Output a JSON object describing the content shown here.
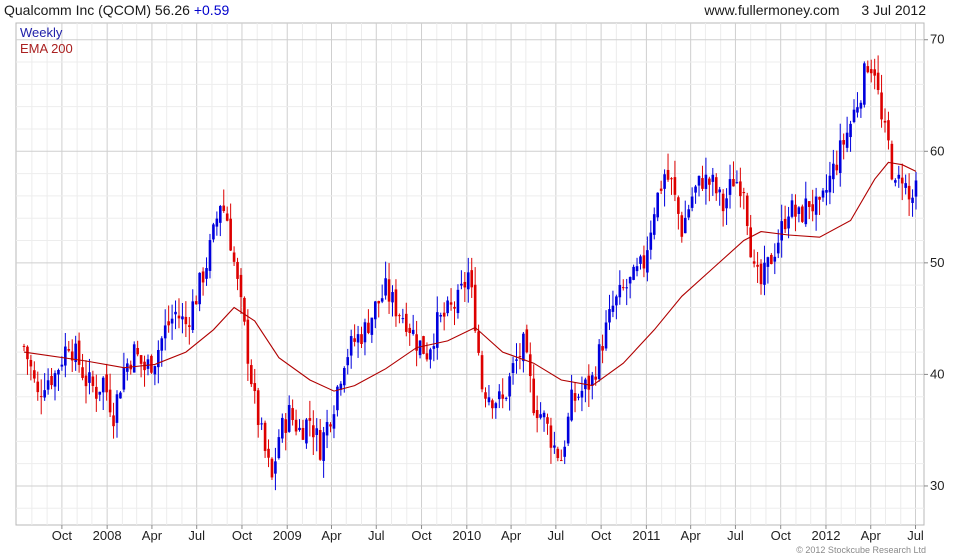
{
  "header": {
    "security": "Qualcomm Inc (QCOM)",
    "last": "56.26",
    "change": "+0.59",
    "site": "www.fullermoney.com",
    "date": "3 Jul 2012"
  },
  "copyright": "© 2012 Stockcube Research Ltd",
  "colors": {
    "up": "#0000dd",
    "down": "#dd0000",
    "ema": "#b00000",
    "grid": "#cfcfcf",
    "legend_weekly": "#2020aa",
    "legend_ema": "#aa2020"
  },
  "chart_data": {
    "type": "candlestick",
    "title": "Qualcomm Inc (QCOM)",
    "frequency": "Weekly",
    "grid": true,
    "legend": {
      "placement": "top-left",
      "entries": [
        "Weekly",
        "EMA 200"
      ]
    },
    "y_axis": {
      "position": "right",
      "ylim": [
        26.5,
        71.5
      ],
      "ticks": [
        30,
        40,
        50,
        60,
        70
      ]
    },
    "x_axis": {
      "range": [
        "2007-07-16",
        "2012-07-02"
      ],
      "tick_labels": [
        {
          "label": "Oct",
          "date": "2007-10-01"
        },
        {
          "label": "2008",
          "date": "2008-01-01"
        },
        {
          "label": "Apr",
          "date": "2008-04-01"
        },
        {
          "label": "Jul",
          "date": "2008-07-01"
        },
        {
          "label": "Oct",
          "date": "2008-10-01"
        },
        {
          "label": "2009",
          "date": "2009-01-01"
        },
        {
          "label": "Apr",
          "date": "2009-04-01"
        },
        {
          "label": "Jul",
          "date": "2009-07-01"
        },
        {
          "label": "Oct",
          "date": "2009-10-01"
        },
        {
          "label": "2010",
          "date": "2010-01-01"
        },
        {
          "label": "Apr",
          "date": "2010-04-01"
        },
        {
          "label": "Jul",
          "date": "2010-07-01"
        },
        {
          "label": "Oct",
          "date": "2010-10-01"
        },
        {
          "label": "2011",
          "date": "2011-01-01"
        },
        {
          "label": "Apr",
          "date": "2011-04-01"
        },
        {
          "label": "Jul",
          "date": "2011-07-01"
        },
        {
          "label": "Oct",
          "date": "2011-10-01"
        },
        {
          "label": "2012",
          "date": "2012-01-01"
        },
        {
          "label": "Apr",
          "date": "2012-04-01"
        },
        {
          "label": "Jul",
          "date": "2012-07-01"
        }
      ]
    },
    "price_close_path": [
      [
        "2007-07-16",
        42.5
      ],
      [
        "2007-07-30",
        40.5
      ],
      [
        "2007-08-13",
        38.0
      ],
      [
        "2007-08-27",
        39.5
      ],
      [
        "2007-09-17",
        40.0
      ],
      [
        "2007-10-01",
        41.5
      ],
      [
        "2007-10-15",
        43.0
      ],
      [
        "2007-11-05",
        41.0
      ],
      [
        "2007-11-19",
        39.5
      ],
      [
        "2007-12-10",
        38.5
      ],
      [
        "2007-12-24",
        39.5
      ],
      [
        "2008-01-14",
        36.5
      ],
      [
        "2008-02-04",
        40.5
      ],
      [
        "2008-02-25",
        42.0
      ],
      [
        "2008-03-17",
        40.5
      ],
      [
        "2008-04-07",
        41.5
      ],
      [
        "2008-04-28",
        44.0
      ],
      [
        "2008-05-19",
        45.5
      ],
      [
        "2008-06-09",
        44.5
      ],
      [
        "2008-06-30",
        47.0
      ],
      [
        "2008-07-21",
        50.0
      ],
      [
        "2008-08-04",
        52.5
      ],
      [
        "2008-08-18",
        55.5
      ],
      [
        "2008-09-01",
        54.0
      ],
      [
        "2008-09-15",
        50.0
      ],
      [
        "2008-10-06",
        44.0
      ],
      [
        "2008-10-27",
        37.5
      ],
      [
        "2008-11-17",
        33.0
      ],
      [
        "2008-12-01",
        30.5
      ],
      [
        "2008-12-15",
        34.5
      ],
      [
        "2009-01-05",
        36.5
      ],
      [
        "2009-01-26",
        35.0
      ],
      [
        "2009-02-16",
        36.0
      ],
      [
        "2009-03-09",
        33.5
      ],
      [
        "2009-04-06",
        37.5
      ],
      [
        "2009-04-27",
        41.5
      ],
      [
        "2009-05-18",
        43.0
      ],
      [
        "2009-06-08",
        44.0
      ],
      [
        "2009-06-29",
        46.0
      ],
      [
        "2009-07-20",
        47.5
      ],
      [
        "2009-08-10",
        46.0
      ],
      [
        "2009-08-31",
        45.0
      ],
      [
        "2009-09-21",
        43.0
      ],
      [
        "2009-10-12",
        42.0
      ],
      [
        "2009-11-02",
        44.5
      ],
      [
        "2009-11-23",
        45.5
      ],
      [
        "2009-12-14",
        46.5
      ],
      [
        "2010-01-04",
        49.0
      ],
      [
        "2010-01-18",
        45.0
      ],
      [
        "2010-02-01",
        39.0
      ],
      [
        "2010-02-22",
        38.0
      ],
      [
        "2010-03-15",
        37.5
      ],
      [
        "2010-04-05",
        40.5
      ],
      [
        "2010-04-26",
        42.5
      ],
      [
        "2010-05-17",
        37.5
      ],
      [
        "2010-06-07",
        36.0
      ],
      [
        "2010-06-28",
        33.5
      ],
      [
        "2010-07-12",
        32.5
      ],
      [
        "2010-08-02",
        37.5
      ],
      [
        "2010-08-23",
        38.5
      ],
      [
        "2010-09-13",
        39.5
      ],
      [
        "2010-10-04",
        43.0
      ],
      [
        "2010-10-25",
        46.0
      ],
      [
        "2010-11-15",
        47.5
      ],
      [
        "2010-12-06",
        48.5
      ],
      [
        "2010-12-27",
        50.0
      ],
      [
        "2011-01-17",
        55.0
      ],
      [
        "2011-02-07",
        58.0
      ],
      [
        "2011-02-21",
        57.0
      ],
      [
        "2011-03-14",
        53.0
      ],
      [
        "2011-04-04",
        56.0
      ],
      [
        "2011-04-25",
        57.5
      ],
      [
        "2011-05-16",
        57.0
      ],
      [
        "2011-06-06",
        55.0
      ],
      [
        "2011-06-27",
        57.5
      ],
      [
        "2011-07-18",
        57.0
      ],
      [
        "2011-08-08",
        49.0
      ],
      [
        "2011-08-22",
        48.0
      ],
      [
        "2011-09-12",
        50.5
      ],
      [
        "2011-10-03",
        53.0
      ],
      [
        "2011-10-17",
        55.0
      ],
      [
        "2011-11-07",
        54.0
      ],
      [
        "2011-11-28",
        55.5
      ],
      [
        "2011-12-19",
        54.5
      ],
      [
        "2012-01-09",
        57.5
      ],
      [
        "2012-01-30",
        60.0
      ],
      [
        "2012-02-20",
        62.5
      ],
      [
        "2012-03-12",
        65.5
      ],
      [
        "2012-03-26",
        68.0
      ],
      [
        "2012-04-09",
        67.5
      ],
      [
        "2012-04-23",
        62.5
      ],
      [
        "2012-05-07",
        60.5
      ],
      [
        "2012-05-21",
        56.5
      ],
      [
        "2012-06-04",
        58.0
      ],
      [
        "2012-06-18",
        55.5
      ],
      [
        "2012-07-02",
        56.26
      ]
    ],
    "ema_200": [
      [
        "2007-07-16",
        42.0
      ],
      [
        "2007-11-19",
        41.2
      ],
      [
        "2008-02-04",
        40.6
      ],
      [
        "2008-04-07",
        40.9
      ],
      [
        "2008-06-09",
        42.0
      ],
      [
        "2008-08-04",
        44.0
      ],
      [
        "2008-09-15",
        46.0
      ],
      [
        "2008-10-27",
        44.8
      ],
      [
        "2008-12-15",
        41.5
      ],
      [
        "2009-02-16",
        39.5
      ],
      [
        "2009-04-06",
        38.5
      ],
      [
        "2009-05-18",
        39.0
      ],
      [
        "2009-07-20",
        40.5
      ],
      [
        "2009-09-21",
        42.4
      ],
      [
        "2009-11-23",
        43.0
      ],
      [
        "2010-01-18",
        44.2
      ],
      [
        "2010-03-15",
        42.0
      ],
      [
        "2010-05-17",
        41.0
      ],
      [
        "2010-07-12",
        39.5
      ],
      [
        "2010-09-13",
        39.0
      ],
      [
        "2010-11-15",
        41.0
      ],
      [
        "2011-01-17",
        44.0
      ],
      [
        "2011-03-14",
        47.0
      ],
      [
        "2011-05-16",
        49.5
      ],
      [
        "2011-07-18",
        52.0
      ],
      [
        "2011-08-22",
        52.8
      ],
      [
        "2011-10-17",
        52.5
      ],
      [
        "2011-12-19",
        52.3
      ],
      [
        "2012-02-20",
        53.8
      ],
      [
        "2012-04-09",
        57.5
      ],
      [
        "2012-05-07",
        59.0
      ],
      [
        "2012-06-04",
        58.8
      ],
      [
        "2012-07-02",
        58.2
      ]
    ]
  }
}
